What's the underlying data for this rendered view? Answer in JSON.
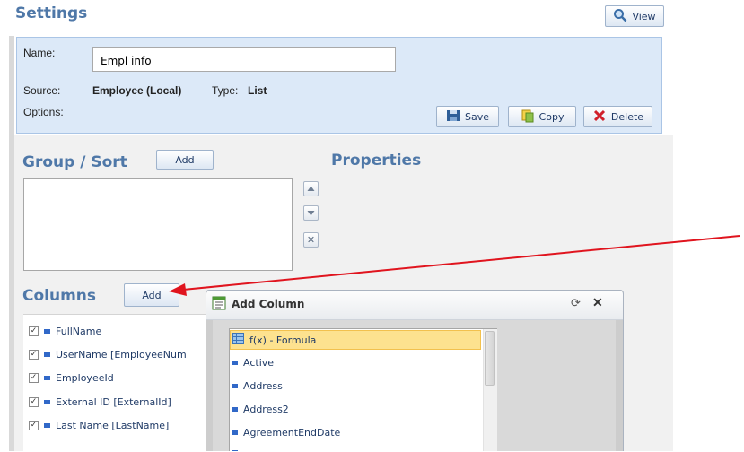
{
  "settings": {
    "title": "Settings",
    "view_label": "View",
    "name_label": "Name:",
    "name_value": "Empl info",
    "source_label": "Source:",
    "source_value": "Employee (Local)",
    "type_label": "Type:",
    "type_value": "List",
    "options_label": "Options:",
    "save_label": "Save",
    "copy_label": "Copy",
    "delete_label": "Delete"
  },
  "group_sort": {
    "title": "Group / Sort",
    "add_label": "Add"
  },
  "properties": {
    "title": "Properties"
  },
  "columns": {
    "title": "Columns",
    "add_label": "Add",
    "items": [
      {
        "label": "FullName",
        "checked": true
      },
      {
        "label": "UserName [EmployeeNum",
        "checked": true
      },
      {
        "label": "EmployeeId",
        "checked": true
      },
      {
        "label": "External ID [ExternalId]",
        "checked": true
      },
      {
        "label": "Last Name [LastName]",
        "checked": true
      }
    ]
  },
  "add_column_dialog": {
    "title": "Add Column",
    "items": [
      {
        "label": "f(x) - Formula",
        "selected": true,
        "icon": "formula-icon"
      },
      {
        "label": "Active",
        "icon": "field-icon"
      },
      {
        "label": "Address",
        "icon": "field-icon"
      },
      {
        "label": "Address2",
        "icon": "field-icon"
      },
      {
        "label": "AgreementEndDate",
        "icon": "field-icon"
      }
    ]
  },
  "colors": {
    "accent": "#4f78a8",
    "panel_bg": "#dce9f8",
    "annotation_arrow": "#e0141e",
    "selected_item": "#fde28f"
  }
}
